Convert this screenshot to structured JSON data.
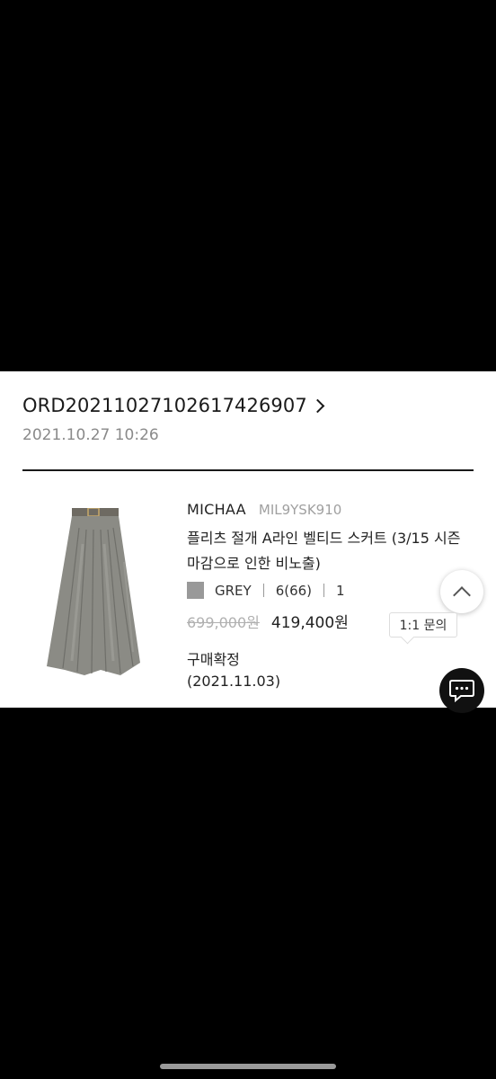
{
  "order": {
    "number": "ORD20211027102617426907",
    "date": "2021.10.27 10:26"
  },
  "product": {
    "brand": "MICHAA",
    "sku": "MIL9YSK910",
    "name": "플리츠 절개 A라인 벨티드 스커트 (3/15 시즌마감으로 인한 비노출)",
    "color_swatch": "#999999",
    "color": "GREY",
    "size": "6(66)",
    "quantity": "1",
    "original_price": "699,000원",
    "sale_price": "419,400원",
    "status": "구매확정",
    "status_date": "(2021.11.03)"
  },
  "floating": {
    "inquiry_label": "1:1 문의",
    "scroll_up_icon": "chevron-up-icon",
    "chat_icon": "chat-bubble-icon"
  }
}
